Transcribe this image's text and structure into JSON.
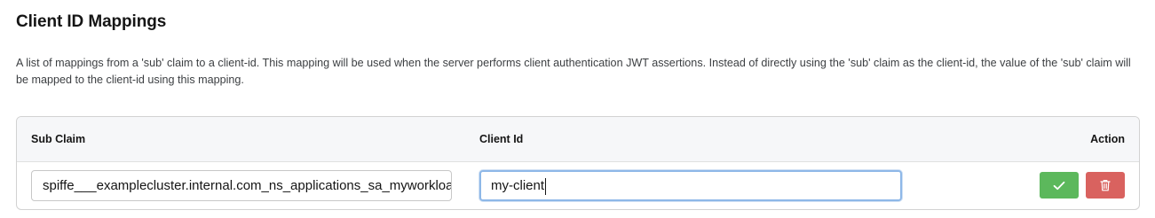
{
  "section": {
    "title": "Client ID Mappings",
    "description": "A list of mappings from a 'sub' claim to a client-id. This mapping will be used when the server performs client authentication JWT assertions. Instead of directly using the 'sub' claim as the client-id, the value of the 'sub' claim will be mapped to the client-id using this mapping."
  },
  "table": {
    "headers": {
      "sub_claim": "Sub Claim",
      "client_id": "Client Id",
      "action": "Action"
    },
    "rows": [
      {
        "sub_claim": "spiffe___examplecluster.internal.com_ns_applications_sa_myworkload",
        "client_id": "my-client"
      }
    ]
  },
  "icons": {
    "confirm": "check-icon",
    "delete": "trash-icon"
  },
  "colors": {
    "confirm_button": "#5cb85c",
    "delete_button": "#d9625f",
    "focus_border": "#8eb8e8"
  }
}
